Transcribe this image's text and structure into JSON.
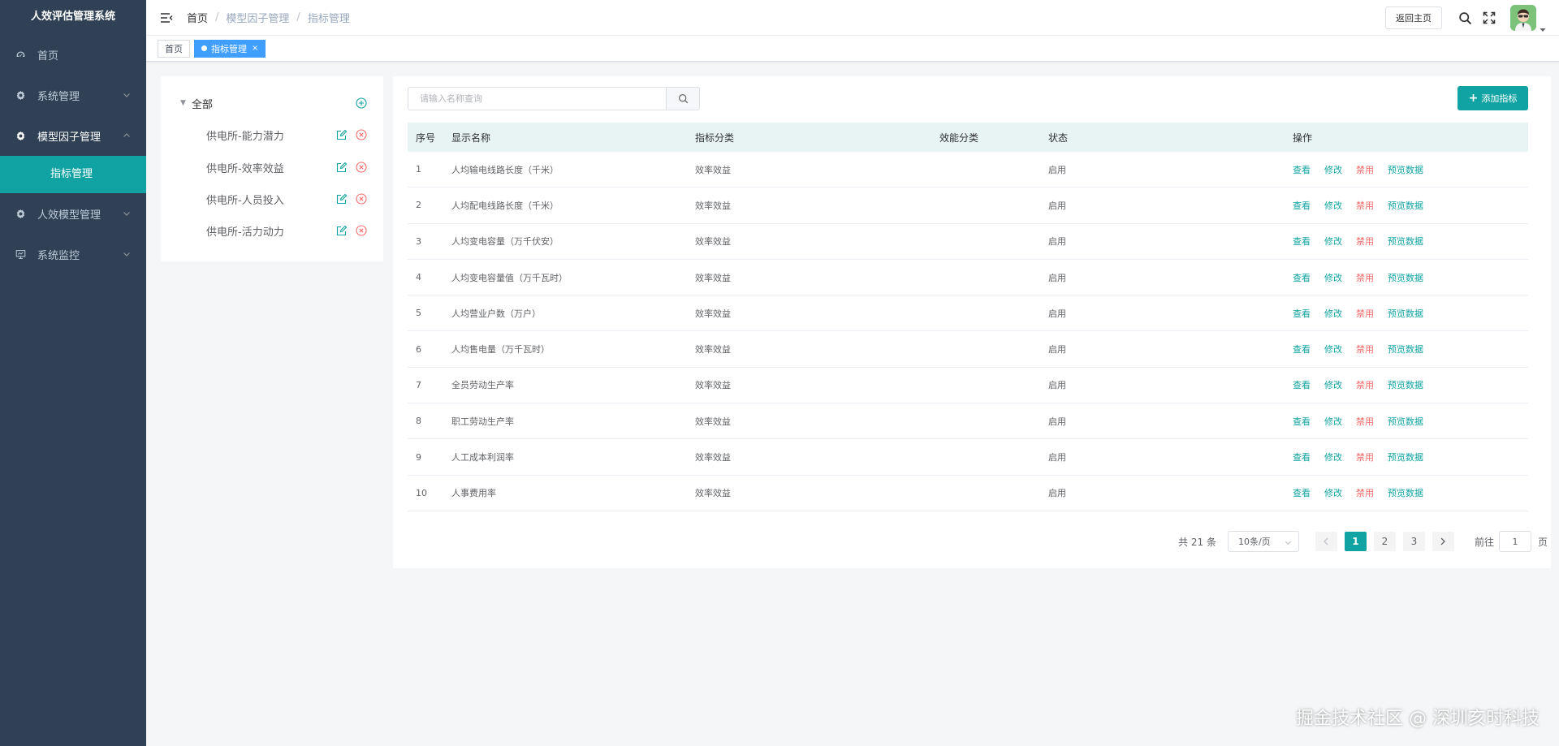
{
  "app": {
    "title": "人效评估管理系统"
  },
  "sidebar": {
    "items": [
      {
        "label": "首页",
        "icon": "dashboard-icon",
        "has_children": false
      },
      {
        "label": "系统管理",
        "icon": "gear-icon",
        "has_children": true
      },
      {
        "label": "模型因子管理",
        "icon": "gear-icon",
        "has_children": true,
        "open": true
      },
      {
        "label": "人效模型管理",
        "icon": "gear-icon",
        "has_children": true
      },
      {
        "label": "系统监控",
        "icon": "monitor-icon",
        "has_children": true
      }
    ],
    "active_submenu": "指标管理"
  },
  "header": {
    "breadcrumb": [
      "首页",
      "模型因子管理",
      "指标管理"
    ],
    "back_button": "返回主页"
  },
  "tags": [
    {
      "label": "首页",
      "active": false
    },
    {
      "label": "指标管理",
      "active": true
    }
  ],
  "tree": {
    "root": "全部",
    "nodes": [
      "供电所-能力潜力",
      "供电所-效率效益",
      "供电所-人员投入",
      "供电所-活力动力"
    ]
  },
  "toolbar": {
    "search_placeholder": "请输入名称查询",
    "add_label": "添加指标"
  },
  "table": {
    "columns": [
      "序号",
      "显示名称",
      "指标分类",
      "效能分类",
      "状态",
      "操作"
    ],
    "actions": [
      "查看",
      "修改",
      "禁用",
      "预览数据"
    ],
    "rows": [
      {
        "idx": "1",
        "name": "人均输电线路长度（千米）",
        "category": "效率效益",
        "eff": "",
        "status": "启用"
      },
      {
        "idx": "2",
        "name": "人均配电线路长度（千米）",
        "category": "效率效益",
        "eff": "",
        "status": "启用"
      },
      {
        "idx": "3",
        "name": "人均变电容量（万千伏安）",
        "category": "效率效益",
        "eff": "",
        "status": "启用"
      },
      {
        "idx": "4",
        "name": "人均变电容量值（万千瓦时）",
        "category": "效率效益",
        "eff": "",
        "status": "启用"
      },
      {
        "idx": "5",
        "name": "人均营业户数（万户）",
        "category": "效率效益",
        "eff": "",
        "status": "启用"
      },
      {
        "idx": "6",
        "name": "人均售电量（万千瓦时）",
        "category": "效率效益",
        "eff": "",
        "status": "启用"
      },
      {
        "idx": "7",
        "name": "全员劳动生产率",
        "category": "效率效益",
        "eff": "",
        "status": "启用"
      },
      {
        "idx": "8",
        "name": "职工劳动生产率",
        "category": "效率效益",
        "eff": "",
        "status": "启用"
      },
      {
        "idx": "9",
        "name": "人工成本利润率",
        "category": "效率效益",
        "eff": "",
        "status": "启用"
      },
      {
        "idx": "10",
        "name": "人事费用率",
        "category": "效率效益",
        "eff": "",
        "status": "启用"
      }
    ]
  },
  "pagination": {
    "total_text": "共 21 条",
    "page_size": "10条/页",
    "pages": [
      "1",
      "2",
      "3"
    ],
    "current": "1",
    "goto_label": "前往",
    "goto_value": "1",
    "page_unit": "页"
  },
  "watermark": "掘金技术社区 @ 深圳亥时科技",
  "colors": {
    "sidebar_bg": "#304156",
    "accent": "#11a3a3",
    "tag_active": "#409eff",
    "danger": "#f56c6c"
  }
}
